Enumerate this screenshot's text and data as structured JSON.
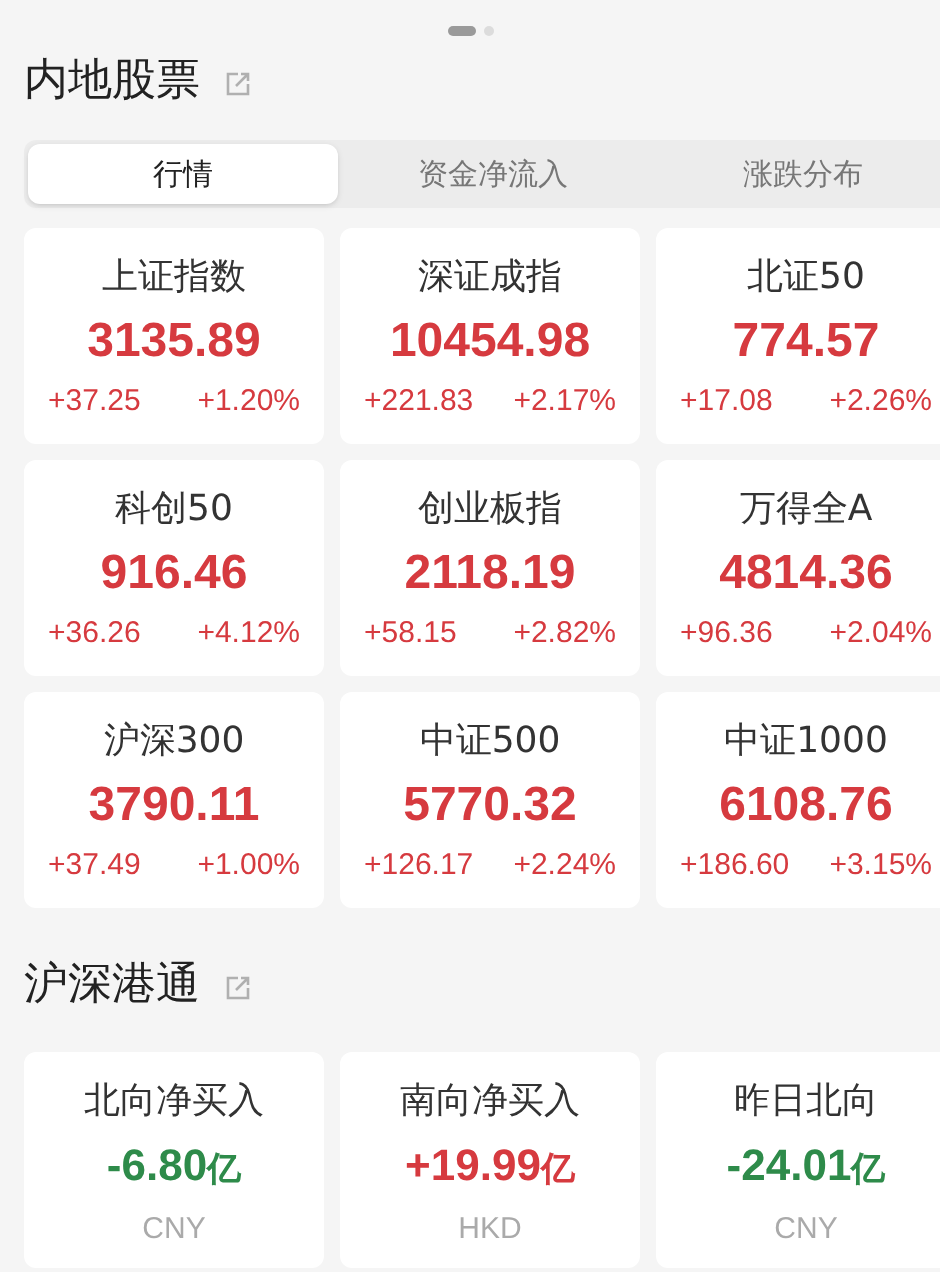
{
  "pager": [
    {
      "selected": true
    },
    {
      "selected": false
    }
  ],
  "sections": [
    {
      "title": "内地股票",
      "tabs": [
        {
          "label": "行情",
          "selected": true
        },
        {
          "label": "资金净流入",
          "selected": false
        },
        {
          "label": "涨跌分布",
          "selected": false
        }
      ],
      "cards": [
        {
          "kind": "index",
          "name": "上证指数",
          "value": "3135.89",
          "change": "+37.25",
          "percent": "+1.20%",
          "rising": true
        },
        {
          "kind": "index",
          "name": "深证成指",
          "value": "10454.98",
          "change": "+221.83",
          "percent": "+2.17%",
          "rising": true
        },
        {
          "kind": "index",
          "name": "北证50",
          "value": "774.57",
          "change": "+17.08",
          "percent": "+2.26%",
          "rising": true
        },
        {
          "kind": "index",
          "name": "科创50",
          "value": "916.46",
          "change": "+36.26",
          "percent": "+4.12%",
          "rising": true
        },
        {
          "kind": "index",
          "name": "创业板指",
          "value": "2118.19",
          "change": "+58.15",
          "percent": "+2.82%",
          "rising": true
        },
        {
          "kind": "index",
          "name": "万得全A",
          "value": "4814.36",
          "change": "+96.36",
          "percent": "+2.04%",
          "rising": true
        },
        {
          "kind": "index",
          "name": "沪深300",
          "value": "3790.11",
          "change": "+37.49",
          "percent": "+1.00%",
          "rising": true
        },
        {
          "kind": "index",
          "name": "中证500",
          "value": "5770.32",
          "change": "+126.17",
          "percent": "+2.24%",
          "rising": true
        },
        {
          "kind": "index",
          "name": "中证1000",
          "value": "6108.76",
          "change": "+186.60",
          "percent": "+3.15%",
          "rising": true
        }
      ]
    },
    {
      "title": "沪深港通",
      "cards": [
        {
          "kind": "flow",
          "name": "北向净买入",
          "value": "-6.80",
          "unit": "亿",
          "currency": "CNY",
          "rising": false
        },
        {
          "kind": "flow",
          "name": "南向净买入",
          "value": "+19.99",
          "unit": "亿",
          "currency": "HKD",
          "rising": true
        },
        {
          "kind": "flow",
          "name": "昨日北向",
          "value": "-24.01",
          "unit": "亿",
          "currency": "CNY",
          "rising": false
        }
      ]
    }
  ]
}
